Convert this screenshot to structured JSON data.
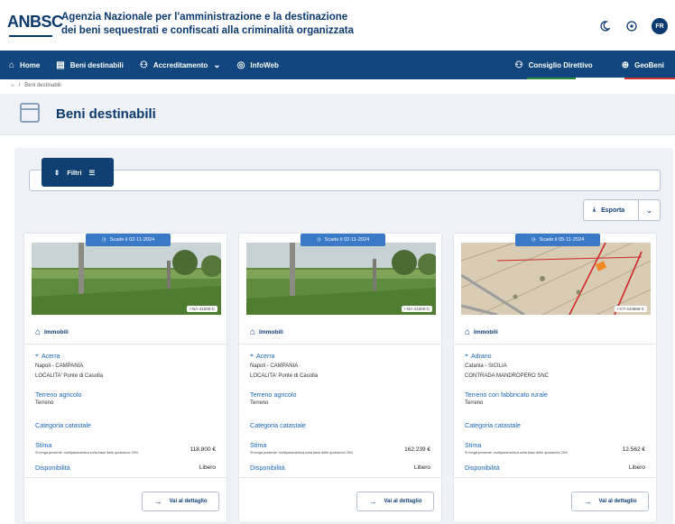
{
  "header": {
    "logo": "ANBSC",
    "agency_line1": "Agenzia Nazionale per l'amministrazione e la destinazione",
    "agency_line2": "dei beni sequestrati e confiscati alla criminalità organizzata",
    "avatar_initials": "FR"
  },
  "nav": {
    "items": [
      {
        "label": "Home",
        "icon": "home-icon"
      },
      {
        "label": "Beni destinabili",
        "icon": "list-icon"
      },
      {
        "label": "Accreditamento",
        "icon": "users-icon"
      },
      {
        "label": "InfoWeb",
        "icon": "globe-icon"
      }
    ],
    "right_items": [
      {
        "label": "Consiglio Direttivo",
        "icon": "people-icon"
      },
      {
        "label": "GeoBeni",
        "icon": "map-icon"
      }
    ]
  },
  "breadcrumb": {
    "current": "Beni destinabili"
  },
  "page": {
    "title": "Beni destinabili"
  },
  "filters": {
    "label": "Filtri"
  },
  "export": {
    "label": "Esporta"
  },
  "colors": {
    "primary": "#0f3f73",
    "nav": "#12467e",
    "link": "#1a67b5",
    "badge": "#3a79c7"
  },
  "cards": [
    {
      "badge": "Scade il 02-11-2024",
      "image_label": "I-NA-41000-C",
      "type": "Immobili",
      "city": "Acerra",
      "region": "Napoli - CAMPANIA",
      "locality": "LOCALITA' Ponte di Casolla",
      "category": "Terreno agricolo",
      "category_sub": "Terreno",
      "cat_label": "Categoria catastale",
      "stima_label": "Stima",
      "stima_note": "Si tenga presente: multiparametrica sulla base delle quotazioni OMI",
      "stima_value": "118.800 €",
      "disp_label": "Disponibilità",
      "disp_value": "Libero",
      "detail": "Vai al dettaglio"
    },
    {
      "badge": "Scade il 02-11-2024",
      "image_label": "I-NA-41000-C",
      "type": "Immobili",
      "city": "Acerra",
      "region": "Napoli - CAMPANIA",
      "locality": "LOCALITA' Ponte di Casolla",
      "category": "Terreno agricolo",
      "category_sub": "Terreno",
      "cat_label": "Categoria catastale",
      "stima_label": "Stima",
      "stima_note": "Si tenga presente: multiparametrica sulla base delle quotazioni OMI",
      "stima_value": "162.239 €",
      "disp_label": "Disponibilità",
      "disp_value": "Libero",
      "detail": "Vai al dettaglio"
    },
    {
      "badge": "Scade il 05-11-2024",
      "image_label": "I-CT-444886-C",
      "type": "Immobili",
      "city": "Adrano",
      "region": "Catania - SICILIA",
      "locality": "CONTRADA MANDROPERO SNC",
      "category": "Terreno con fabbricato rurale",
      "category_sub": "Terreno",
      "cat_label": "Categoria catastale",
      "stima_label": "Stima",
      "stima_note": "Si tenga presente: multiparametrica sulla base delle quotazioni OMI",
      "stima_value": "12.562 €",
      "disp_label": "Disponibilità",
      "disp_value": "Libero",
      "detail": "Vai al dettaglio"
    }
  ]
}
